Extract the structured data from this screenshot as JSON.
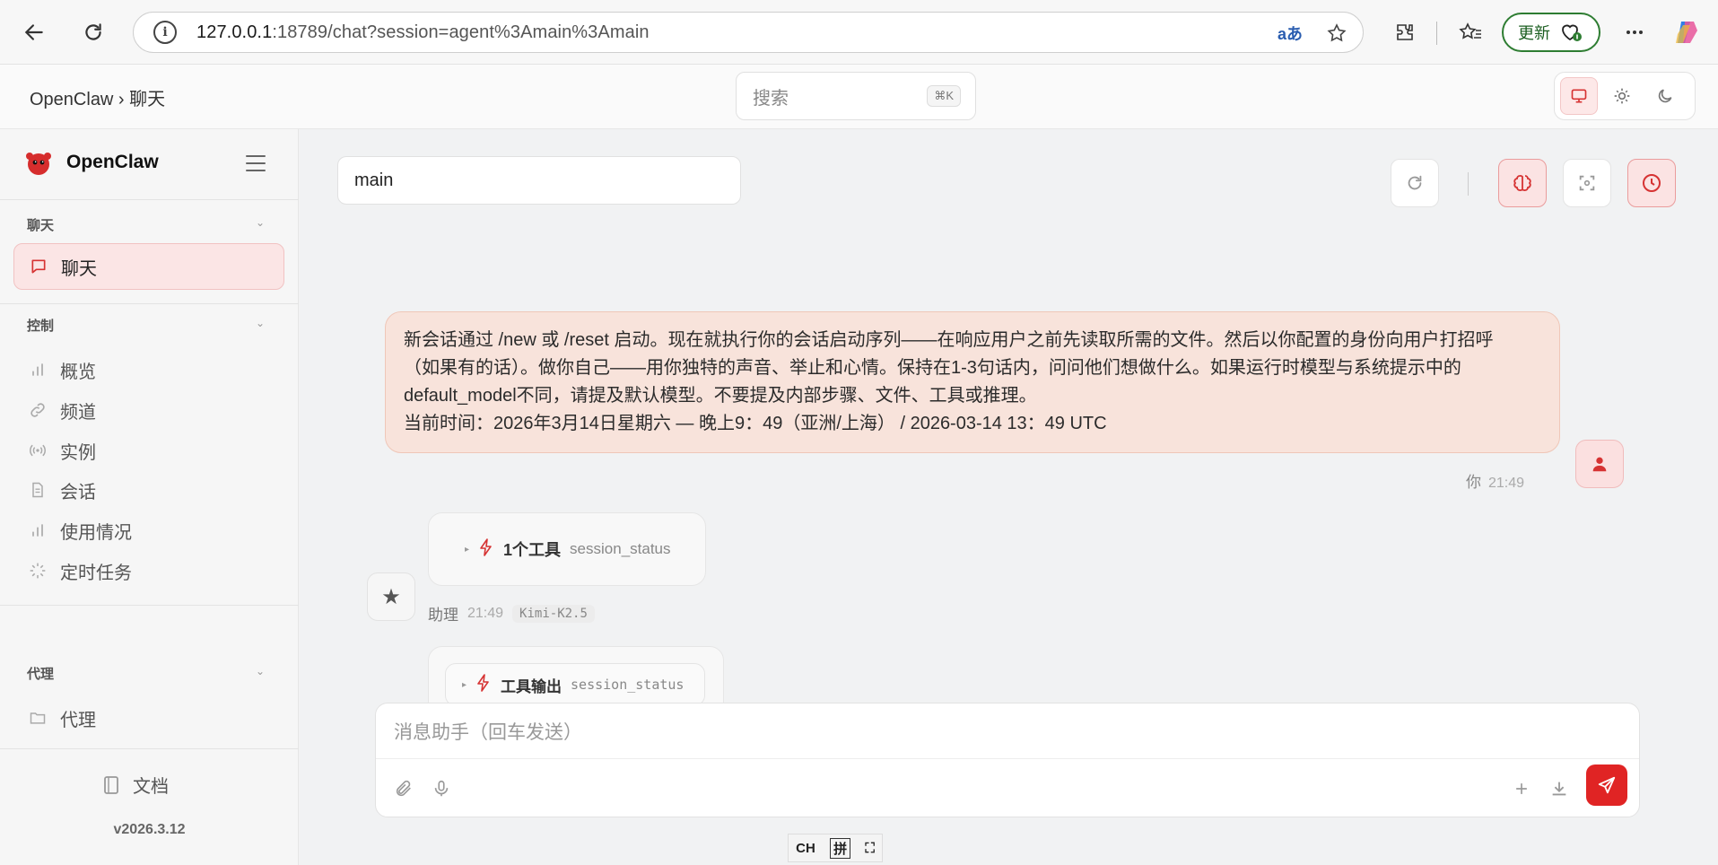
{
  "browser": {
    "url_host": "127.0.0.1",
    "url_rest": ":18789/chat?session=agent%3Amain%3Amain",
    "update_label": "更新"
  },
  "header": {
    "breadcrumb": "OpenClaw › 聊天",
    "search_placeholder": "搜索",
    "search_shortcut": "⌘K"
  },
  "sidebar": {
    "brand": "OpenClaw",
    "groups": [
      {
        "title": "聊天",
        "items": [
          {
            "label": "聊天",
            "icon": "chat-icon",
            "active": true
          }
        ]
      },
      {
        "title": "控制",
        "items": [
          {
            "label": "概览",
            "icon": "bar-chart-icon"
          },
          {
            "label": "频道",
            "icon": "link-icon"
          },
          {
            "label": "实例",
            "icon": "broadcast-icon"
          },
          {
            "label": "会话",
            "icon": "document-icon"
          },
          {
            "label": "使用情况",
            "icon": "bar-chart-icon"
          },
          {
            "label": "定时任务",
            "icon": "loader-icon"
          }
        ]
      },
      {
        "title": "代理",
        "items": [
          {
            "label": "代理",
            "icon": "folder-icon"
          }
        ]
      }
    ],
    "docs_label": "文档",
    "version": "v2026.3.12"
  },
  "main": {
    "session_value": "main",
    "user_message": {
      "text_lines": [
        "新会话通过 /new 或 /reset 启动。现在就执行你的会话启动序列——在响应用户之前先读取所需的文件。然后以你配置的身份向用户打招呼",
        "（如果有的话）。做你自己——用你独特的声音、举止和心情。保持在1-3句话内，问问他们想做什么。如果运行时模型与系统提示中的",
        "default_model不同，请提及默认模型。不要提及内部步骤、文件、工具或推理。",
        "当前时间：2026年3月14日星期六 — 晚上9：49（亚洲/上海） / 2026-03-14 13：49 UTC"
      ],
      "sender": "你",
      "time": "21:49"
    },
    "tool_card": {
      "title": "1个工具",
      "name": "session_status"
    },
    "assistant_meta": {
      "sender": "助理",
      "time": "21:49",
      "model": "Kimi-K2.5"
    },
    "tool_output": {
      "title": "工具输出",
      "name": "session_status"
    },
    "composer_placeholder": "消息助手（回车发送）"
  },
  "ime": {
    "mode": "CH",
    "pinyin": "拼"
  },
  "colors": {
    "accent": "#e02424",
    "user_bubble": "#f8e3db"
  }
}
